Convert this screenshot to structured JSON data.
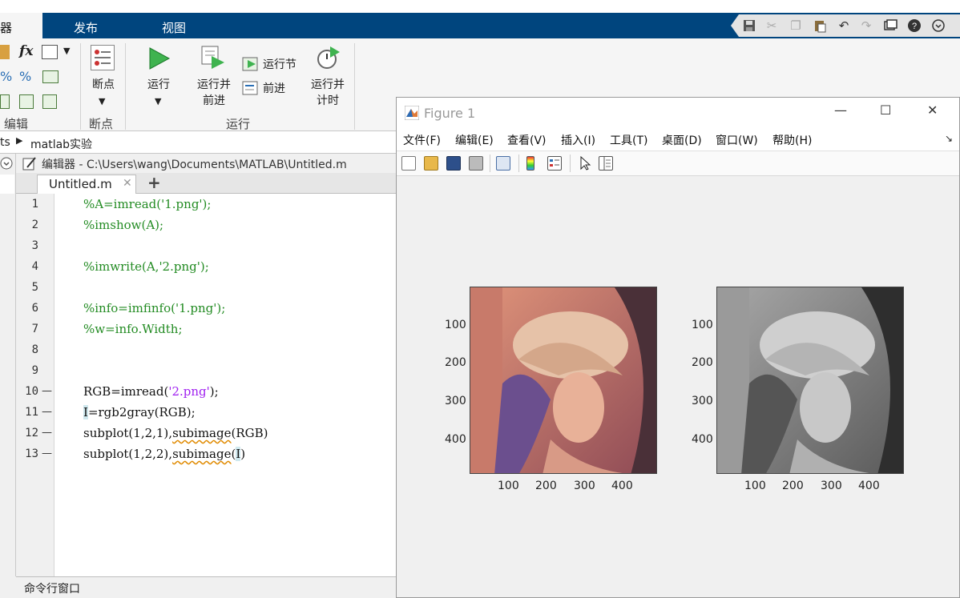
{
  "tabs": {
    "editor_partial": "器",
    "publish": "发布",
    "view": "视图"
  },
  "ribbon": {
    "sections": {
      "edit": "编辑",
      "breakpoints": "断点",
      "run": "运行"
    },
    "breakpoints_label": "断点",
    "run_label": "运行",
    "run_advance_label_1": "运行并",
    "run_advance_label_2": "前进",
    "run_section_label": "运行节",
    "advance_label": "前进",
    "run_time_label_1": "运行并",
    "run_time_label_2": "计时",
    "fx_label": "fx"
  },
  "address": {
    "prefix": "ts",
    "folder": "matlab实验"
  },
  "editor": {
    "title": "编辑器 - C:\\Users\\wang\\Documents\\MATLAB\\Untitled.m",
    "tab_name": "Untitled.m",
    "add_tab": "+",
    "lines": [
      {
        "n": "1",
        "dash": "",
        "code": "%A=imread('1.png');"
      },
      {
        "n": "2",
        "dash": "",
        "code": "%imshow(A);"
      },
      {
        "n": "3",
        "dash": "",
        "code": ""
      },
      {
        "n": "4",
        "dash": "",
        "code": "%imwrite(A,'2.png');"
      },
      {
        "n": "5",
        "dash": "",
        "code": ""
      },
      {
        "n": "6",
        "dash": "",
        "code": "%info=imfinfo('1.png');"
      },
      {
        "n": "7",
        "dash": "",
        "code": "%w=info.Width;"
      },
      {
        "n": "8",
        "dash": "",
        "code": ""
      },
      {
        "n": "9",
        "dash": "",
        "code": ""
      },
      {
        "n": "10",
        "dash": "—",
        "code": "RGB=imread('2.png');"
      },
      {
        "n": "11",
        "dash": "—",
        "code": "I=rgb2gray(RGB);"
      },
      {
        "n": "12",
        "dash": "—",
        "code": "subplot(1,2,1),subimage(RGB)"
      },
      {
        "n": "13",
        "dash": "—",
        "code": "subplot(1,2,2),subimage(I)"
      }
    ],
    "code_parts": {
      "l10_a": "RGB=imread(",
      "l10_b": "'2.png'",
      "l10_c": ");",
      "l11_a": "I",
      "l11_b": "=rgb2gray(RGB);",
      "l12_a": "subplot(1,2,1),",
      "l12_b": "subimage",
      "l12_c": "(RGB)",
      "l13_a": "subplot(1,2,2),",
      "l13_b": "subimage",
      "l13_c": "(",
      "l13_d": "I",
      "l13_e": ")"
    },
    "command_window": "命令行窗口"
  },
  "figure": {
    "title": "Figure 1",
    "menu": [
      "文件(F)",
      "编辑(E)",
      "查看(V)",
      "插入(I)",
      "工具(T)",
      "桌面(D)",
      "窗口(W)",
      "帮助(H)"
    ],
    "min": "—",
    "max": "☐",
    "close": "✕",
    "yticks": [
      "100",
      "200",
      "300",
      "400"
    ],
    "xticks": [
      "100",
      "200",
      "300",
      "400"
    ]
  }
}
